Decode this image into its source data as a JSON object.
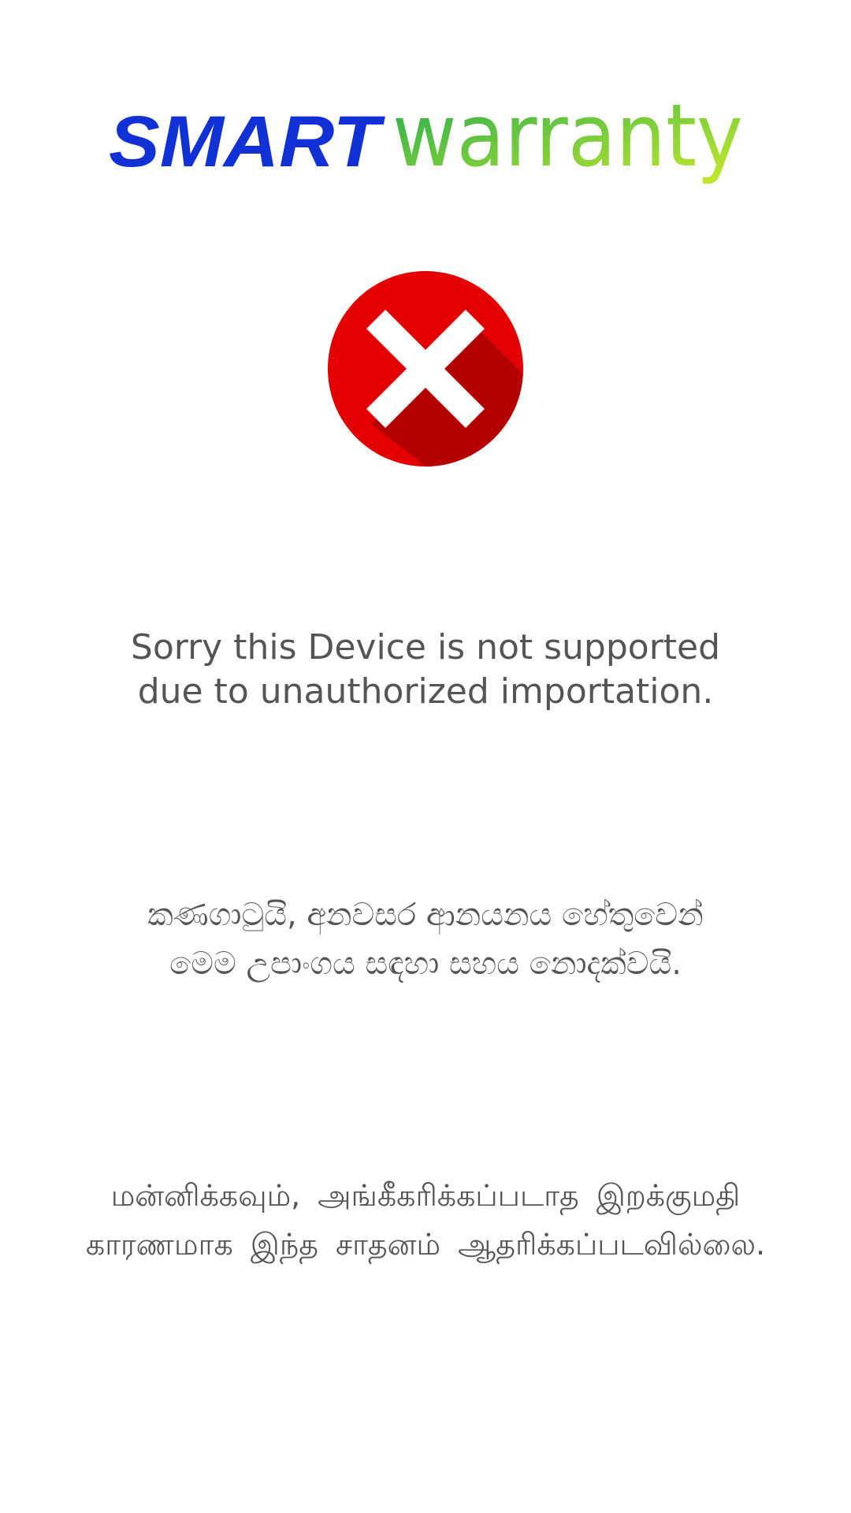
{
  "brand": {
    "word1": "SMART",
    "word2": "warranty",
    "word1_color": "#1130D6",
    "gradient_start": "#1DAA4F",
    "gradient_end": "#CCEB2A"
  },
  "status_icon": {
    "name": "error-x-icon",
    "circle_color": "#E40000",
    "shadow_color": "#B50000",
    "cross_color": "#FFFFFF"
  },
  "messages": {
    "english": {
      "line1": "Sorry this Device is not supported",
      "line2": "due to unauthorized importation."
    },
    "sinhala": {
      "line1": "කණගාටුයි, අනවසර ආනයනය හේතුවෙන්",
      "line2": "මෙම උපාංගය සඳහා සහය නොදක්වයි."
    },
    "tamil": {
      "line1": "மன்னிக்கவும், அங்கீகரிக்கப்படாத இறக்குமதி",
      "line2": "காரணமாக இந்த சாதனம் ஆதரிக்கப்படவில்லை."
    }
  }
}
